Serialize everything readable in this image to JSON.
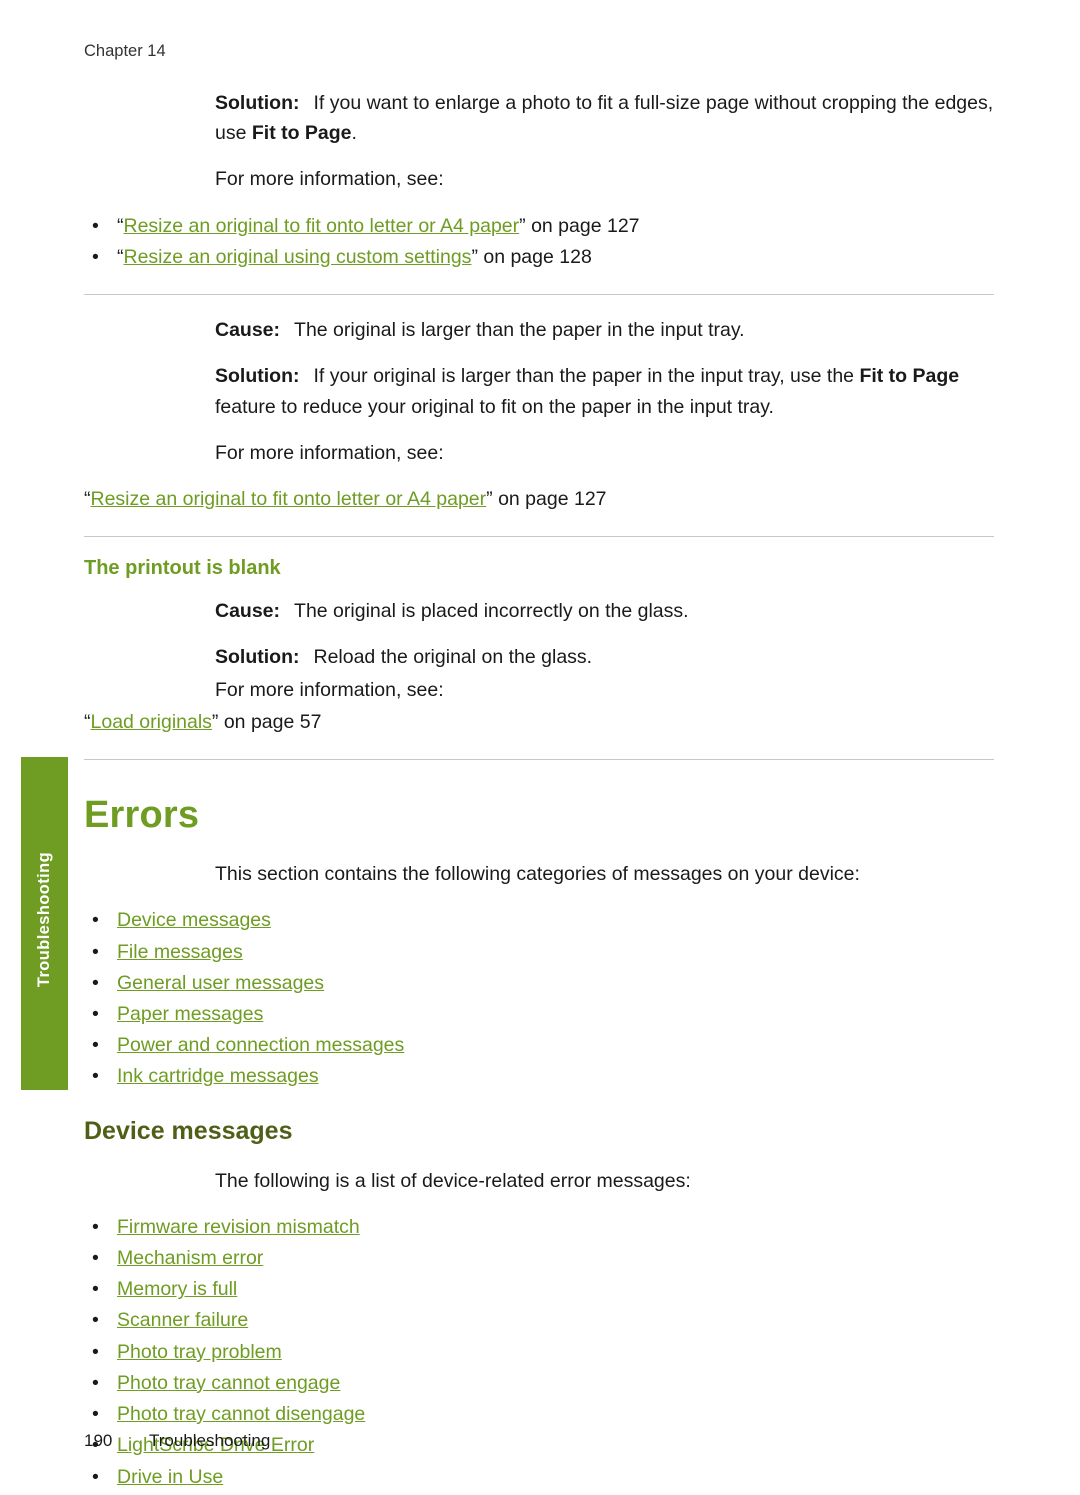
{
  "header": {
    "chapter_label": "Chapter 14"
  },
  "body": {
    "block1": {
      "solution_label": "Solution:",
      "solution_text_1": "If you want to enlarge a photo to fit a full-size page without cropping the edges, use ",
      "solution_bold": "Fit to Page",
      "solution_text_2": ".",
      "more_info": "For more information, see:",
      "links": [
        {
          "quote_open": "“",
          "text": "Resize an original to fit onto letter or A4 paper",
          "quote_close": "” on page 127"
        },
        {
          "quote_open": "“",
          "text": "Resize an original using custom settings",
          "quote_close": "” on page 128"
        }
      ]
    },
    "block2": {
      "cause_label": "Cause:",
      "cause_text": "The original is larger than the paper in the input tray.",
      "solution_label": "Solution:",
      "solution_text_1": "If your original is larger than the paper in the input tray, use the ",
      "solution_bold_1": "Fit to Page",
      "solution_text_2": " feature to reduce your original to fit on the paper in the input tray.",
      "more_info": "For more information, see:",
      "link": {
        "quote_open": "“",
        "text": "Resize an original to fit onto letter or A4 paper",
        "quote_close": "” on page 127"
      }
    },
    "block3": {
      "heading": "The printout is blank",
      "cause_label": "Cause:",
      "cause_text": "The original is placed incorrectly on the glass.",
      "solution_label": "Solution:",
      "solution_text": "Reload the original on the glass.",
      "more_info": "For more information, see:",
      "link": {
        "quote_open": "“",
        "text": "Load originals",
        "quote_close": "” on page 57"
      }
    },
    "errors": {
      "title": "Errors",
      "intro": "This section contains the following categories of messages on your device:",
      "links": [
        "Device messages",
        "File messages",
        "General user messages",
        "Paper messages",
        "Power and connection messages",
        "Ink cartridge messages"
      ]
    },
    "device_messages": {
      "title": "Device messages",
      "intro": "The following is a list of device-related error messages:",
      "links": [
        "Firmware revision mismatch",
        "Mechanism error",
        "Memory is full",
        "Scanner failure",
        "Photo tray problem",
        "Photo tray cannot engage",
        "Photo tray cannot disengage",
        "LightScribe Drive Error",
        "Drive in Use"
      ]
    }
  },
  "sidebar": {
    "tab_label": "Troubleshooting"
  },
  "footer": {
    "page_number": "190",
    "section": "Troubleshooting"
  },
  "colors": {
    "accent_green": "#6f9c22",
    "heading_green": "#4f5f17",
    "rule": "#c8c8c8"
  }
}
